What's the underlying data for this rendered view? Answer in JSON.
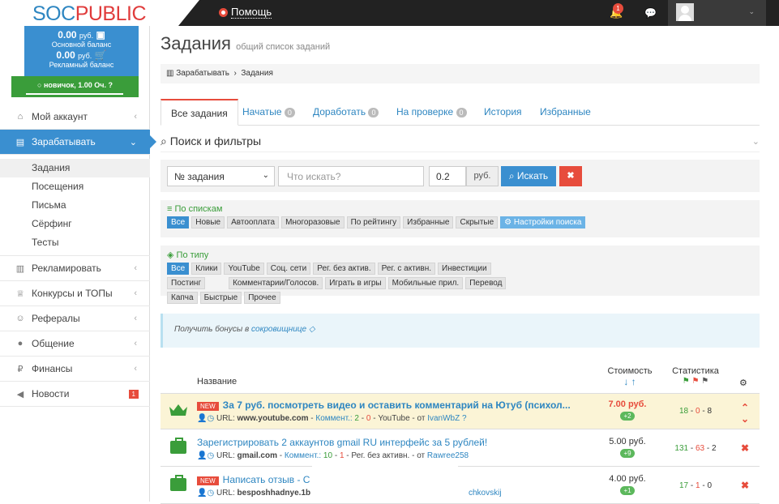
{
  "logo": {
    "part1": "SOC",
    "part2": "PUBLIC"
  },
  "topbar": {
    "help": "Помощь",
    "notifications": "1"
  },
  "balance": {
    "main_value": "0.00",
    "main_currency": "руб.",
    "main_label": "Основной баланс",
    "ad_value": "0.00",
    "ad_currency": "руб.",
    "ad_label": "Рекламный баланс",
    "level": "новичок, 1.00 Оч."
  },
  "sidebar": {
    "items": [
      {
        "label": "Мой аккаунт"
      },
      {
        "label": "Зарабатывать"
      },
      {
        "label": "Рекламировать"
      },
      {
        "label": "Конкурсы и ТОПы"
      },
      {
        "label": "Рефералы"
      },
      {
        "label": "Общение"
      },
      {
        "label": "Финансы"
      },
      {
        "label": "Новости",
        "badge": "1"
      }
    ],
    "sub": [
      "Задания",
      "Посещения",
      "Письма",
      "Сёрфинг",
      "Тесты"
    ]
  },
  "page": {
    "title": "Задания",
    "subtitle": "общий список заданий"
  },
  "breadcrumb": {
    "first": "Зарабатывать",
    "second": "Задания"
  },
  "tabs": [
    {
      "label": "Все задания"
    },
    {
      "label": "Начатые",
      "count": "0"
    },
    {
      "label": "Доработать",
      "count": "0"
    },
    {
      "label": "На проверке",
      "count": "0"
    },
    {
      "label": "История"
    },
    {
      "label": "Избранные"
    }
  ],
  "search": {
    "heading": "Поиск и фильтры",
    "select_value": "№ задания",
    "query_placeholder": "Что искать?",
    "price_value": "0.2",
    "price_unit": "руб.",
    "find_label": "Искать",
    "clear_label": "✖"
  },
  "filter_lists": {
    "label": "По спискам",
    "tags": [
      "Все",
      "Новые",
      "Автооплата",
      "Многоразовые",
      "По рейтингу",
      "Избранные",
      "Скрытые"
    ],
    "settings": "Настройки поиска"
  },
  "filter_types": {
    "label": "По типу",
    "tags": [
      "Все",
      "Клики",
      "YouTube",
      "Соц. сети",
      "Рег. без актив.",
      "Рег. с активн.",
      "Инвестиции",
      "Постинг",
      "Комментарии/Голосов.",
      "Играть в игры",
      "Мобильные прил.",
      "Перевод",
      "Капча",
      "Быстрые",
      "Прочее"
    ]
  },
  "info": {
    "text": "Получить бонусы в ",
    "link": "сокровищнице"
  },
  "table": {
    "col_name": "Название",
    "col_cost": "Стоимость",
    "col_stat": "Статистика",
    "rows": [
      {
        "new": "NEW",
        "title": "За 7 руб. посмотреть видео и оставить комментарий на Ютуб (психол...",
        "url_label": "URL: ",
        "url": "www.youtube.com",
        "comment": "Коммент.: ",
        "c1": "2",
        "c2": "0",
        "cat": "YouTube",
        "from": " - от ",
        "author": "IvanWbZ",
        "cost": "7.00 руб.",
        "plus": "+2",
        "s1": "18",
        "s2": "0",
        "s3": "8"
      },
      {
        "new": "",
        "title": "Зарегистрировать 2 аккаунтов gmail RU интерфейс за 5 рублей!",
        "url_label": "URL: ",
        "url": "gmail.com",
        "comment": "Коммент.: ",
        "c1": "10",
        "c2": "1",
        "cat": "Рег. без активн.",
        "from": " - от ",
        "author": "Rawree258",
        "cost": "5.00 руб.",
        "plus": "+9",
        "s1": "131",
        "s2": "63",
        "s3": "2"
      },
      {
        "new": "NEW",
        "title": "Написать отзыв - С",
        "url_label": "URL: ",
        "url": "besposhhadnye.1b",
        "comment": "",
        "c1": "",
        "c2": "",
        "cat": "",
        "from": "",
        "author": "chkovskij",
        "cost": "4.00 руб.",
        "plus": "+1",
        "s1": "17",
        "s2": "1",
        "s3": "0"
      }
    ]
  }
}
